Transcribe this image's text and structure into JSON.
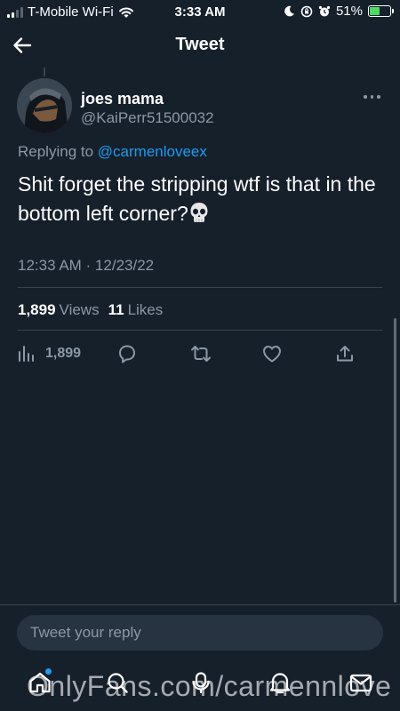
{
  "status_bar": {
    "carrier": "T-Mobile Wi-Fi",
    "time": "3:33 AM",
    "battery": "51%",
    "battery_level": 0.51
  },
  "header": {
    "title": "Tweet"
  },
  "tweet": {
    "author_name": "joes mama",
    "author_handle": "@KaiPerr51500032",
    "replying_prefix": "Replying to",
    "replying_to": "@carmenloveex",
    "text": "Shit forget the stripping wtf is that in the bottom left corner?",
    "timestamp": "12:33 AM · 12/23/22",
    "views_count": "1,899",
    "views_label": "Views",
    "likes_count": "11",
    "likes_label": "Likes"
  },
  "actions": {
    "views_count": "1,899"
  },
  "reply": {
    "placeholder": "Tweet your reply"
  },
  "watermark": {
    "text": "OnlyFans.com/carmennlove"
  },
  "colors": {
    "background": "#15202b",
    "accent": "#1d9bf0",
    "secondary_text": "#8b98a5",
    "divider": "#38444d"
  },
  "icons": [
    "back-arrow-icon",
    "more-icon",
    "views-chart-icon",
    "reply-icon",
    "retweet-icon",
    "like-icon",
    "share-icon",
    "home-icon",
    "search-icon",
    "spaces-icon",
    "notifications-icon",
    "messages-icon",
    "skull-emoji"
  ]
}
